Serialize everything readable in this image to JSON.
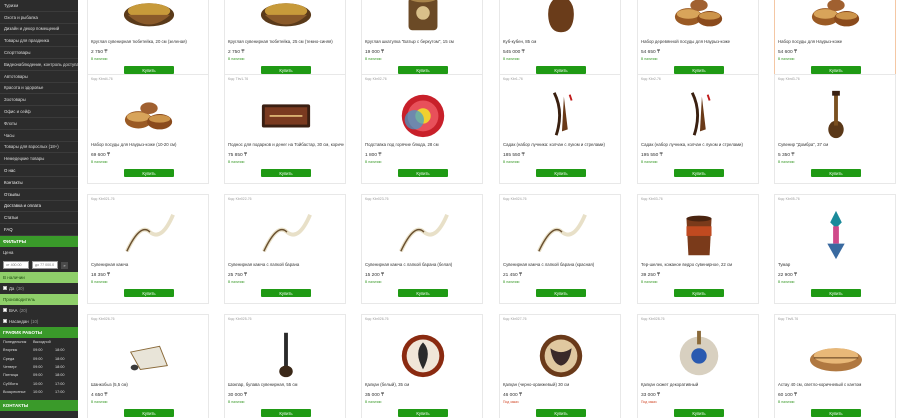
{
  "colors": {
    "accent": "#3a9a2a",
    "buy_button": "#1f9a14",
    "sidebar_bg": "#2c2c2c",
    "in_stock": "#3a9a2a",
    "on_order": "#d24a2a"
  },
  "sidebar": {
    "menu": [
      "Туризм",
      "Охота и рыбалка",
      "Дизайн и декор помещений",
      "Товары для праздника",
      "Спорттовары",
      "Видеонаблюдение, контроль доступа, радиосвязь",
      "Автотовары",
      "Красота и здоровье",
      "Зоотовары",
      "Офис и сейф",
      "Флоты",
      "Часы",
      "Товары для взрослых (18+)",
      "Немедецкие товары"
    ],
    "links": [
      "О нас",
      "Контакты",
      "Отзывы",
      "Доставка и оплата",
      "Статьи",
      "FAQ"
    ],
    "filters_title": "ФИЛЬТРЫ",
    "price_label": "Цена",
    "price_from_placeholder": "от 400.00",
    "price_to_placeholder": "до 77 000.0",
    "price_go": "»",
    "in_stock_label": "В наличии",
    "in_stock_yes": "Да",
    "in_stock_yes_count": "(30)",
    "manufacturer_label": "Производитель",
    "brands": [
      {
        "name": "ВАА",
        "count": "(20)"
      },
      {
        "name": "Насандан",
        "count": "(10)"
      }
    ],
    "hours_title": "ГРАФИК РАБОТЫ",
    "hours_head": {
      "day": "Понедельник",
      "off": "Выходной"
    },
    "hours": [
      {
        "day": "Вторник",
        "from": "09:00",
        "to": "18:00"
      },
      {
        "day": "Среда",
        "from": "09:00",
        "to": "18:00"
      },
      {
        "day": "Четверг",
        "from": "09:00",
        "to": "18:00"
      },
      {
        "day": "Пятница",
        "from": "09:00",
        "to": "18:00"
      },
      {
        "day": "Суббота",
        "from": "10:00",
        "to": "17:00"
      },
      {
        "day": "Воскресенье",
        "from": "10:00",
        "to": "17:00"
      }
    ],
    "contacts_title": "КОНТАКТЫ"
  },
  "buy_label": "Купить",
  "in_stock_text": "В наличии",
  "on_order_text": "Под заказ",
  "products": [
    {
      "code": "",
      "name": "Круглая сувенирная тюбетейка, 20 см (зеленая)",
      "price": "2 750 ₸",
      "stock": "in",
      "img": "bowl"
    },
    {
      "code": "",
      "name": "Круглая сувенирная тюбетейка, 25 см (темно-синяя)",
      "price": "2 750 ₸",
      "stock": "in",
      "img": "bowl"
    },
    {
      "code": "",
      "name": "Круглая шкатулка \"Батыр с беркутом\", 15 см",
      "price": "19 000 ₸",
      "stock": "in",
      "img": "box"
    },
    {
      "code": "",
      "name": "Куб-кубен, 85 см",
      "price": "545 000 ₸",
      "stock": "in",
      "img": "vase"
    },
    {
      "code": "",
      "name": "Набор деревянной посуды для Наурыз-коже",
      "price": "54 650 ₸",
      "stock": "in",
      "img": "bowlset"
    },
    {
      "code": "",
      "name": "Набор посуды для Наурыз-коже",
      "price": "54 600 ₸",
      "stock": "in",
      "img": "bowlset"
    },
    {
      "code": "Код: Kbrd4-76",
      "name": "Набор посуды для Наурыз-коже (10-20 см)",
      "price": "69 600 ₸",
      "stock": "in",
      "img": "bowlset"
    },
    {
      "code": "Код: Tbv1-76",
      "name": "Поднос для подарков и денег на Тойбастар, 30 см, коричневый",
      "price": "75 850 ₸",
      "stock": "in",
      "img": "tray"
    },
    {
      "code": "Код: Kbr02-76",
      "name": "Подставка под горячие блюда, 28 см",
      "price": "1 800 ₸",
      "stock": "in",
      "img": "plate"
    },
    {
      "code": "Код: Kbr1-76",
      "name": "Садак (набор лучника: колчан с луком и стрелами)",
      "price": "185 550 ₸",
      "stock": "in",
      "img": "quiver"
    },
    {
      "code": "Код: Kbr2-76",
      "name": "Садак (набор лучника, колчан с луком и стрелами)",
      "price": "195 550 ₸",
      "stock": "in",
      "img": "quiver"
    },
    {
      "code": "Код: Kbrd3-76",
      "name": "Сувенир \"Домбра\", 37 см",
      "price": "5 350 ₸",
      "stock": "in",
      "img": "dombra"
    },
    {
      "code": "Код: Kbr021-76",
      "name": "Сувенирная камча",
      "price": "18 350 ₸",
      "stock": "in",
      "img": "whip"
    },
    {
      "code": "Код: Kbr022-76",
      "name": "Сувенирная камча с лапкой барана",
      "price": "25 750 ₸",
      "stock": "in",
      "img": "whip"
    },
    {
      "code": "Код: Kbr023-76",
      "name": "Сувенирная камча с лапкой барана (белая)",
      "price": "15 200 ₸",
      "stock": "in",
      "img": "whip"
    },
    {
      "code": "Код: Kbr024-76",
      "name": "Сувенирная камча с лапкой барана (красная)",
      "price": "21 450 ₸",
      "stock": "in",
      "img": "whip"
    },
    {
      "code": "Код: Kbr03-76",
      "name": "Тер-шелек, кожаное ведро сувенирное, 22 см",
      "price": "39 250 ₸",
      "stock": "in",
      "img": "bucket"
    },
    {
      "code": "Код: Kbr05-76",
      "name": "Тумар",
      "price": "22 900 ₸",
      "stock": "in",
      "img": "tumar"
    },
    {
      "code": "Код: Kbr026-76",
      "name": "Шанкобыз (5,5 см)",
      "price": "4 650 ₸",
      "stock": "in",
      "img": "harp"
    },
    {
      "code": "Код: Kbr025-76",
      "name": "Шокпар, булава сувенирная, 55 см",
      "price": "30 000 ₸",
      "stock": "in",
      "img": "mace"
    },
    {
      "code": "Код: Kbr026-76",
      "name": "Қалқан (белый), 35 см",
      "price": "35 000 ₸",
      "stock": "in",
      "img": "shield"
    },
    {
      "code": "Код: Kbr027-76",
      "name": "Қалқан (черно-оранжевый) 30 см",
      "price": "46 000 ₸",
      "stock": "order",
      "img": "shield2"
    },
    {
      "code": "Код: Kbr028-76",
      "name": "Қалқан сюжет декоративный",
      "price": "33 000 ₸",
      "stock": "order",
      "img": "shield3"
    },
    {
      "code": "Код: Tbv5-76",
      "name": "Астау 40 см, светло-коричневый с кантом",
      "price": "60 100 ₸",
      "stock": "in",
      "img": "astau"
    }
  ],
  "scroll_top": "+7 (701) 999-07-09"
}
